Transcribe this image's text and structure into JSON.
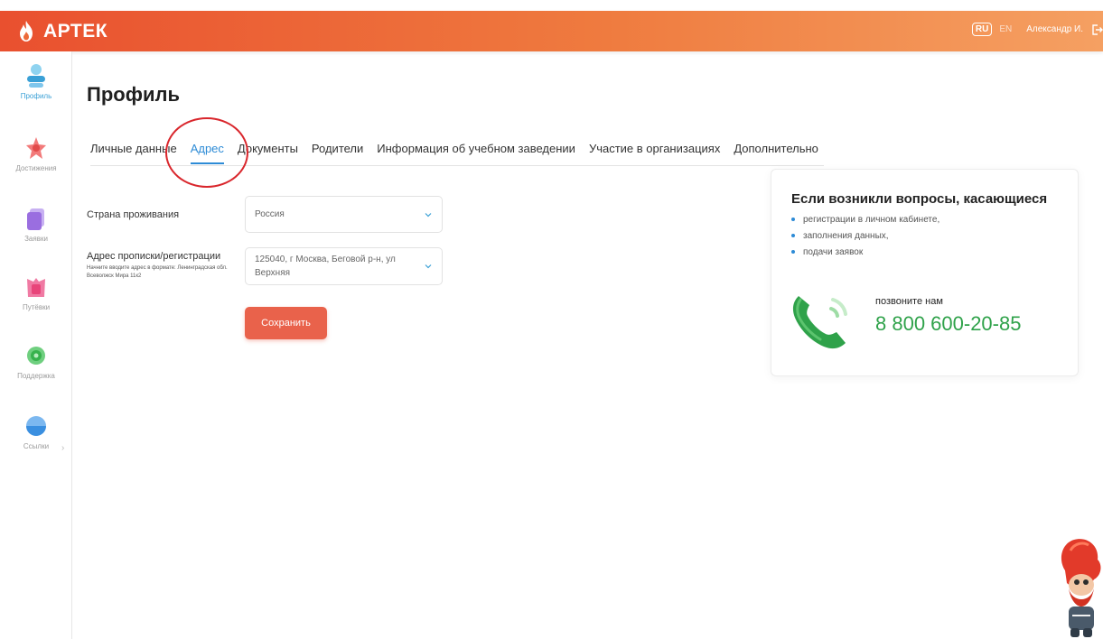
{
  "header": {
    "brand": "АРТЕК",
    "lang_active": "RU",
    "lang_other": "EN",
    "user": "Александр И."
  },
  "sidebar": {
    "items": [
      {
        "label": "Профиль",
        "icon": "profile-icon",
        "color": "#3aa0d6",
        "active": true
      },
      {
        "label": "Достижения",
        "icon": "achievements-icon",
        "color": "#f05a5a"
      },
      {
        "label": "Заявки",
        "icon": "applications-icon",
        "color": "#9a6ee0"
      },
      {
        "label": "Путёвки",
        "icon": "vouchers-icon",
        "color": "#e8457a"
      },
      {
        "label": "Поддержка",
        "icon": "support-icon",
        "color": "#37b24d"
      },
      {
        "label": "Ссылки",
        "icon": "links-icon",
        "color": "#3a8fe0",
        "chevron": "›"
      }
    ]
  },
  "page": {
    "title": "Профиль",
    "tabs": [
      {
        "label": "Личные данные"
      },
      {
        "label": "Адрес",
        "active": true
      },
      {
        "label": "Документы"
      },
      {
        "label": "Родители"
      },
      {
        "label": "Информация об учебном заведении"
      },
      {
        "label": "Участие в организациях"
      },
      {
        "label": "Дополнительно"
      }
    ]
  },
  "form": {
    "country_label": "Страна проживания",
    "country_value": "Россия",
    "address_label": "Адрес прописки/регистрации",
    "address_hint": "Начните вводите адрес в формате: Ленинградская обл. Всеволжск Мира 11к2",
    "address_value": "125040, г Москва, Беговой р-н, ул Верхняя",
    "save_label": "Сохранить"
  },
  "help": {
    "title": "Если возникли вопросы, касающиеся",
    "items": [
      "регистрации в личном кабинете,",
      "заполнения данных,",
      "подачи заявок"
    ],
    "call_label": "позвоните нам",
    "phone": "8 800 600-20-85"
  },
  "colors": {
    "accent_blue": "#2d8bd6",
    "save_button": "#e9624b",
    "phone_green": "#2fa24a",
    "annotation_red": "#d9262c"
  }
}
